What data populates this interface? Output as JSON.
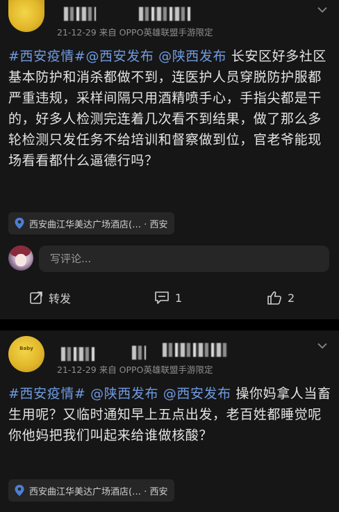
{
  "posts": [
    {
      "meta": "21-12-29  来自 OPPO英雄联盟手游限定",
      "segments": [
        {
          "text": "#西安疫情#",
          "link": true
        },
        {
          "text": "@西安发布",
          "link": true
        },
        {
          "text": " ",
          "link": false
        },
        {
          "text": "@陕西发布",
          "link": true
        },
        {
          "text": " 长安区好多社区基本防护和消杀都做不到，连医护人员穿脱防护服都严重违规，采样间隔只用酒精喷手心，手指尖都是干的，好多人检测完连着几次看不到结果，做了那么多轮检测只发任务不给培训和督察做到位，官老爷能现场看看都什么逼德行吗？",
          "link": false
        }
      ],
      "location": "西安曲江华美达广场酒店(… · 西安",
      "comment_placeholder": "写评论...",
      "repost_label": "转发",
      "comment_count": "1",
      "like_count": "2"
    },
    {
      "meta": "21-12-29  来自 OPPO英雄联盟手游限定",
      "logo_text": "Baby",
      "segments": [
        {
          "text": "#西安疫情#",
          "link": true
        },
        {
          "text": " ",
          "link": false
        },
        {
          "text": "@陕西发布",
          "link": true
        },
        {
          "text": " ",
          "link": false
        },
        {
          "text": "@西安发布",
          "link": true
        },
        {
          "text": " 操你妈拿人当畜生用呢？又临时通知早上五点出发，老百姓都睡觉呢你他妈把我们叫起来给谁做核酸？",
          "link": false
        }
      ],
      "location": "西安曲江华美达广场酒店(… · 西安"
    }
  ]
}
